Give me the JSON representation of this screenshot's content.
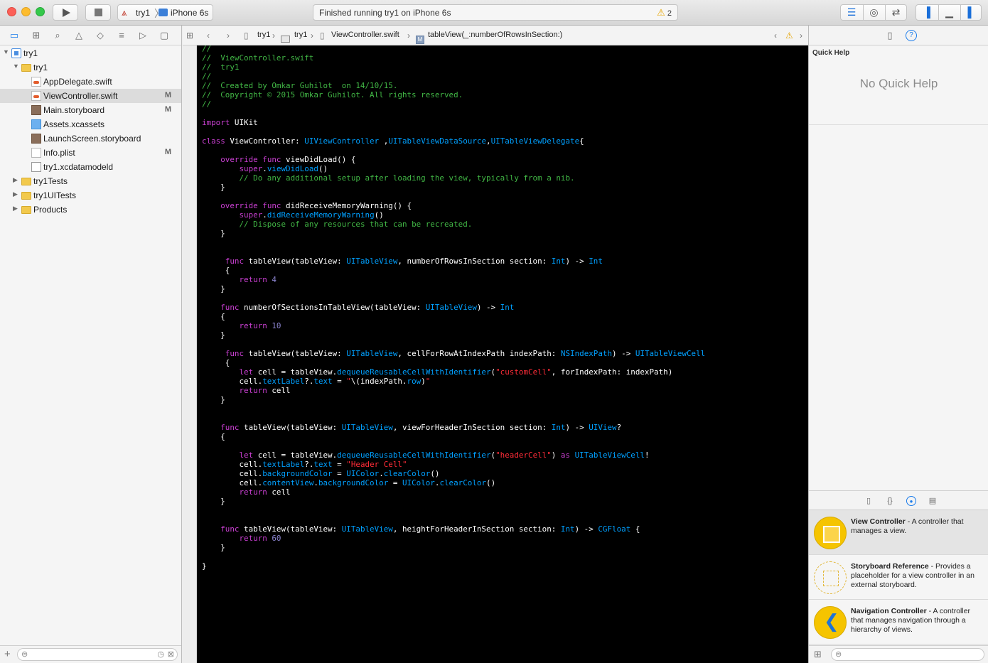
{
  "toolbar": {
    "scheme_name": "try1",
    "device_name": "iPhone 6s",
    "status_text": "Finished running try1 on iPhone 6s",
    "warning_count": "2"
  },
  "navigator": {
    "items": [
      {
        "label": "try1",
        "icon": "project-icon",
        "indent": 0,
        "disclosure": "▼",
        "badge": ""
      },
      {
        "label": "try1",
        "icon": "folder-icon",
        "indent": 1,
        "disclosure": "▼",
        "badge": ""
      },
      {
        "label": "AppDelegate.swift",
        "icon": "swift-file-icon",
        "indent": 2,
        "disclosure": "",
        "badge": ""
      },
      {
        "label": "ViewController.swift",
        "icon": "swift-file-icon",
        "indent": 2,
        "disclosure": "",
        "badge": "M",
        "selected": true
      },
      {
        "label": "Main.storyboard",
        "icon": "storyboard-icon",
        "indent": 2,
        "disclosure": "",
        "badge": "M"
      },
      {
        "label": "Assets.xcassets",
        "icon": "assets-icon",
        "indent": 2,
        "disclosure": "",
        "badge": ""
      },
      {
        "label": "LaunchScreen.storyboard",
        "icon": "storyboard-icon",
        "indent": 2,
        "disclosure": "",
        "badge": ""
      },
      {
        "label": "Info.plist",
        "icon": "plist-icon",
        "indent": 2,
        "disclosure": "",
        "badge": "M"
      },
      {
        "label": "try1.xcdatamodeld",
        "icon": "datamodel-icon",
        "indent": 2,
        "disclosure": "",
        "badge": ""
      },
      {
        "label": "try1Tests",
        "icon": "folder-icon",
        "indent": 1,
        "disclosure": "▶",
        "badge": ""
      },
      {
        "label": "try1UITests",
        "icon": "folder-icon",
        "indent": 1,
        "disclosure": "▶",
        "badge": ""
      },
      {
        "label": "Products",
        "icon": "folder-icon",
        "indent": 1,
        "disclosure": "▶",
        "badge": ""
      }
    ]
  },
  "jumpbar": {
    "project": "try1",
    "group": "try1",
    "file": "ViewController.swift",
    "symbol": "tableView(_:numberOfRowsInSection:)"
  },
  "editor": {
    "lines": [
      [
        [
          "cm",
          "//"
        ]
      ],
      [
        [
          "cm",
          "//  ViewController.swift"
        ]
      ],
      [
        [
          "cm",
          "//  try1"
        ]
      ],
      [
        [
          "cm",
          "//"
        ]
      ],
      [
        [
          "cm",
          "//  Created by Omkar Guhilot  on 14/10/15."
        ]
      ],
      [
        [
          "cm",
          "//  Copyright © 2015 Omkar Guhilot. All rights reserved."
        ]
      ],
      [
        [
          "cm",
          "//"
        ]
      ],
      [],
      [
        [
          "kw",
          "import"
        ],
        [
          "pl",
          " UIKit"
        ]
      ],
      [],
      [
        [
          "kw",
          "class"
        ],
        [
          "pl",
          " ViewController: "
        ],
        [
          "ty",
          "UIViewController"
        ],
        [
          "pl",
          " ,"
        ],
        [
          "ty",
          "UITableViewDataSource"
        ],
        [
          "pl",
          ","
        ],
        [
          "ty",
          "UITableViewDelegate"
        ],
        [
          "pl",
          "{"
        ]
      ],
      [],
      [
        [
          "pl",
          "    "
        ],
        [
          "kw",
          "override"
        ],
        [
          "pl",
          " "
        ],
        [
          "kw",
          "func"
        ],
        [
          "pl",
          " viewDidLoad() {"
        ]
      ],
      [
        [
          "pl",
          "        "
        ],
        [
          "kw",
          "super"
        ],
        [
          "pl",
          "."
        ],
        [
          "ty",
          "viewDidLoad"
        ],
        [
          "pl",
          "()"
        ]
      ],
      [
        [
          "pl",
          "        "
        ],
        [
          "cm",
          "// Do any additional setup after loading the view, typically from a nib."
        ]
      ],
      [
        [
          "pl",
          "    }"
        ]
      ],
      [],
      [
        [
          "pl",
          "    "
        ],
        [
          "kw",
          "override"
        ],
        [
          "pl",
          " "
        ],
        [
          "kw",
          "func"
        ],
        [
          "pl",
          " didReceiveMemoryWarning() {"
        ]
      ],
      [
        [
          "pl",
          "        "
        ],
        [
          "kw",
          "super"
        ],
        [
          "pl",
          "."
        ],
        [
          "ty",
          "didReceiveMemoryWarning"
        ],
        [
          "pl",
          "()"
        ]
      ],
      [
        [
          "pl",
          "        "
        ],
        [
          "cm",
          "// Dispose of any resources that can be recreated."
        ]
      ],
      [
        [
          "pl",
          "    }"
        ]
      ],
      [],
      [],
      [
        [
          "pl",
          "     "
        ],
        [
          "kw",
          "func"
        ],
        [
          "pl",
          " tableView(tableView: "
        ],
        [
          "ty",
          "UITableView"
        ],
        [
          "pl",
          ", numberOfRowsInSection section: "
        ],
        [
          "ty",
          "Int"
        ],
        [
          "pl",
          ") -> "
        ],
        [
          "ty",
          "Int"
        ]
      ],
      [
        [
          "pl",
          "     {"
        ]
      ],
      [
        [
          "pl",
          "        "
        ],
        [
          "kw",
          "return"
        ],
        [
          "pl",
          " "
        ],
        [
          "nm",
          "4"
        ]
      ],
      [
        [
          "pl",
          "    }"
        ]
      ],
      [],
      [
        [
          "pl",
          "    "
        ],
        [
          "kw",
          "func"
        ],
        [
          "pl",
          " numberOfSectionsInTableView(tableView: "
        ],
        [
          "ty",
          "UITableView"
        ],
        [
          "pl",
          ") -> "
        ],
        [
          "ty",
          "Int"
        ]
      ],
      [
        [
          "pl",
          "    {"
        ]
      ],
      [
        [
          "pl",
          "        "
        ],
        [
          "kw",
          "return"
        ],
        [
          "pl",
          " "
        ],
        [
          "nm",
          "10"
        ]
      ],
      [
        [
          "pl",
          "    }"
        ]
      ],
      [],
      [
        [
          "pl",
          "     "
        ],
        [
          "kw",
          "func"
        ],
        [
          "pl",
          " tableView(tableView: "
        ],
        [
          "ty",
          "UITableView"
        ],
        [
          "pl",
          ", cellForRowAtIndexPath indexPath: "
        ],
        [
          "ty",
          "NSIndexPath"
        ],
        [
          "pl",
          ") -> "
        ],
        [
          "ty",
          "UITableViewCell"
        ]
      ],
      [
        [
          "pl",
          "     {"
        ]
      ],
      [
        [
          "pl",
          "        "
        ],
        [
          "kw",
          "let"
        ],
        [
          "pl",
          " cell = tableView."
        ],
        [
          "ty",
          "dequeueReusableCellWithIdentifier"
        ],
        [
          "pl",
          "("
        ],
        [
          "st",
          "\"customCell\""
        ],
        [
          "pl",
          ", forIndexPath: indexPath)"
        ]
      ],
      [
        [
          "pl",
          "        cell."
        ],
        [
          "ty",
          "textLabel"
        ],
        [
          "pl",
          "?."
        ],
        [
          "ty",
          "text"
        ],
        [
          "pl",
          " = "
        ],
        [
          "st",
          "\""
        ],
        [
          "pl",
          "\\(indexPath."
        ],
        [
          "ty",
          "row"
        ],
        [
          "pl",
          ")"
        ],
        [
          "st",
          "\""
        ]
      ],
      [
        [
          "pl",
          "        "
        ],
        [
          "kw",
          "return"
        ],
        [
          "pl",
          " cell"
        ]
      ],
      [
        [
          "pl",
          "    }"
        ]
      ],
      [],
      [],
      [
        [
          "pl",
          "    "
        ],
        [
          "kw",
          "func"
        ],
        [
          "pl",
          " tableView(tableView: "
        ],
        [
          "ty",
          "UITableView"
        ],
        [
          "pl",
          ", viewForHeaderInSection section: "
        ],
        [
          "ty",
          "Int"
        ],
        [
          "pl",
          ") -> "
        ],
        [
          "ty",
          "UIView"
        ],
        [
          "pl",
          "?"
        ]
      ],
      [
        [
          "pl",
          "    {"
        ]
      ],
      [],
      [
        [
          "pl",
          "        "
        ],
        [
          "kw",
          "let"
        ],
        [
          "pl",
          " cell = tableView."
        ],
        [
          "ty",
          "dequeueReusableCellWithIdentifier"
        ],
        [
          "pl",
          "("
        ],
        [
          "st",
          "\"headerCell\""
        ],
        [
          "pl",
          ") "
        ],
        [
          "kw",
          "as"
        ],
        [
          "pl",
          " "
        ],
        [
          "ty",
          "UITableViewCell"
        ],
        [
          "pl",
          "!"
        ]
      ],
      [
        [
          "pl",
          "        cell."
        ],
        [
          "ty",
          "textLabel"
        ],
        [
          "pl",
          "?."
        ],
        [
          "ty",
          "text"
        ],
        [
          "pl",
          " = "
        ],
        [
          "st",
          "\"Header Cell\""
        ]
      ],
      [
        [
          "pl",
          "        cell."
        ],
        [
          "ty",
          "backgroundColor"
        ],
        [
          "pl",
          " = "
        ],
        [
          "ty",
          "UIColor"
        ],
        [
          "pl",
          "."
        ],
        [
          "ty",
          "clearColor"
        ],
        [
          "pl",
          "()"
        ]
      ],
      [
        [
          "pl",
          "        cell."
        ],
        [
          "ty",
          "contentView"
        ],
        [
          "pl",
          "."
        ],
        [
          "ty",
          "backgroundColor"
        ],
        [
          "pl",
          " = "
        ],
        [
          "ty",
          "UIColor"
        ],
        [
          "pl",
          "."
        ],
        [
          "ty",
          "clearColor"
        ],
        [
          "pl",
          "()"
        ]
      ],
      [
        [
          "pl",
          "        "
        ],
        [
          "kw",
          "return"
        ],
        [
          "pl",
          " cell"
        ]
      ],
      [
        [
          "pl",
          "    }"
        ]
      ],
      [],
      [],
      [
        [
          "pl",
          "    "
        ],
        [
          "kw",
          "func"
        ],
        [
          "pl",
          " tableView(tableView: "
        ],
        [
          "ty",
          "UITableView"
        ],
        [
          "pl",
          ", heightForHeaderInSection section: "
        ],
        [
          "ty",
          "Int"
        ],
        [
          "pl",
          ") -> "
        ],
        [
          "ty",
          "CGFloat"
        ],
        [
          "pl",
          " {"
        ]
      ],
      [
        [
          "pl",
          "        "
        ],
        [
          "kw",
          "return"
        ],
        [
          "pl",
          " "
        ],
        [
          "nm",
          "60"
        ]
      ],
      [
        [
          "pl",
          "    }"
        ]
      ],
      [],
      [
        [
          "pl",
          "}"
        ]
      ]
    ]
  },
  "quick_help": {
    "title": "Quick Help",
    "empty_text": "No Quick Help"
  },
  "library": {
    "items": [
      {
        "name": "View Controller",
        "desc": " - A controller that manages a view.",
        "icon": "view-controller-icon",
        "selected": true
      },
      {
        "name": "Storyboard Reference",
        "desc": " - Provides a placeholder for a view controller in an external storyboard.",
        "icon": "storyboard-reference-icon",
        "selected": false
      },
      {
        "name": "Navigation Controller",
        "desc": " - A controller that manages navigation through a hierarchy of views.",
        "icon": "navigation-controller-icon",
        "selected": false
      }
    ]
  },
  "colors": {
    "comment": "#41b645",
    "keyword": "#c83fd0",
    "type": "#00a0ff",
    "string": "#ff2c38",
    "number": "#8b84cf",
    "accent": "#1a7ceb"
  }
}
